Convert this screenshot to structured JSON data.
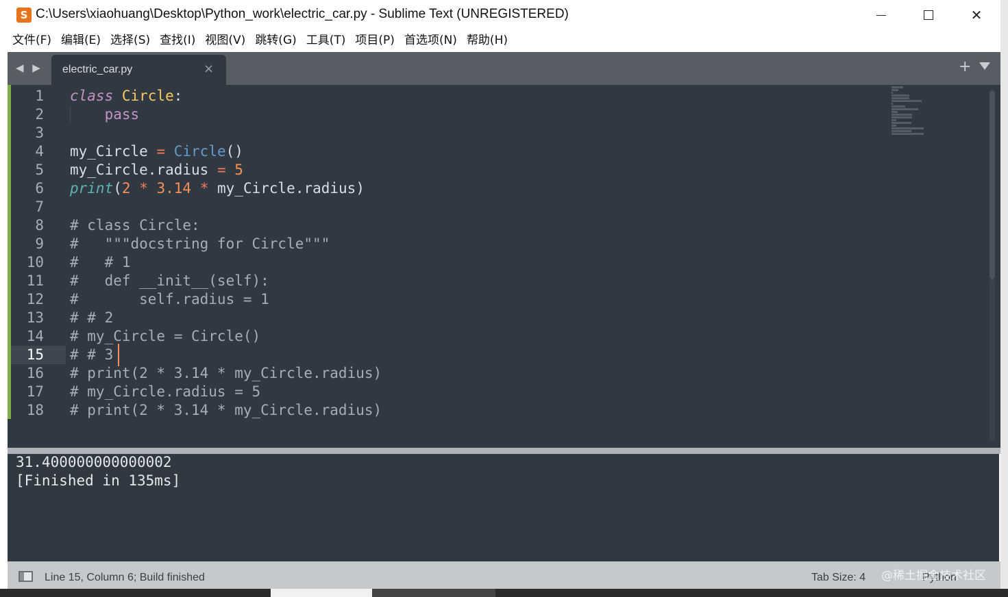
{
  "window": {
    "title": "C:\\Users\\xiaohuang\\Desktop\\Python_work\\electric_car.py - Sublime Text (UNREGISTERED)",
    "close_glyph": "✕"
  },
  "menu": [
    "文件(F)",
    "编辑(E)",
    "选择(S)",
    "查找(I)",
    "视图(V)",
    "跳转(G)",
    "工具(T)",
    "项目(P)",
    "首选项(N)",
    "帮助(H)"
  ],
  "tabs": {
    "nav": "◀ ▶",
    "active_file": "electric_car.py",
    "close_glyph": "×",
    "new_tab_glyph": "+"
  },
  "editor": {
    "active_line": 15,
    "line_numbers": [
      "1",
      "2",
      "3",
      "4",
      "5",
      "6",
      "7",
      "8",
      "9",
      "10",
      "11",
      "12",
      "13",
      "14",
      "15",
      "16",
      "17",
      "18"
    ],
    "lines": [
      "class Circle:",
      "    pass",
      "",
      "my_Circle = Circle()",
      "my_Circle.radius = 5",
      "print(2 * 3.14 * my_Circle.radius)",
      "",
      "# class Circle:",
      "#   \"\"\"docstring for Circle\"\"\"",
      "#   # 1",
      "#   def __init__(self):",
      "#       self.radius = 1",
      "# # 2",
      "# my_Circle = Circle()",
      "# # 3",
      "# print(2 * 3.14 * my_Circle.radius)",
      "# my_Circle.radius = 5",
      "# print(2 * 3.14 * my_Circle.radius)"
    ],
    "colors": {
      "background": "#303841",
      "keyword": "#c594c5",
      "class_name": "#fac863",
      "call": "#6699cc",
      "number": "#f99157",
      "comment": "#a7adba"
    }
  },
  "output": {
    "lines": [
      "31.400000000000002",
      "[Finished in 135ms]"
    ]
  },
  "status": {
    "left": "Line 15, Column 6; Build finished",
    "tab_size": "Tab Size: 4",
    "syntax": "Python",
    "watermark": "@稀土掘金技术社区"
  }
}
